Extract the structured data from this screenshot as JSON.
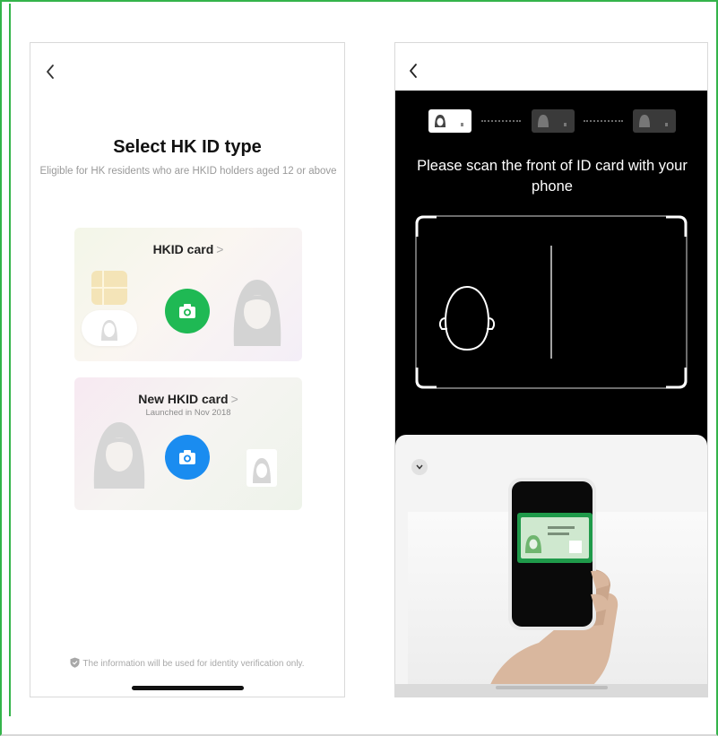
{
  "left_screen": {
    "back_icon": "chevron-left-icon",
    "title": "Select HK ID type",
    "subtitle": "Eligible for HK residents who are HKID holders aged 12 or above",
    "options": [
      {
        "label": "HKID card",
        "chevron": ">",
        "sublabel": "",
        "button_color": "#1fb954",
        "icon": "camera-icon"
      },
      {
        "label": "New HKID card",
        "chevron": ">",
        "sublabel": "Launched in Nov 2018",
        "button_color": "#1a8cf0",
        "icon": "camera-icon"
      }
    ],
    "privacy_note": "The information will be used for identity verification only."
  },
  "right_screen": {
    "back_icon": "chevron-left-icon",
    "steps": [
      {
        "state": "active"
      },
      {
        "state": "pending"
      },
      {
        "state": "pending"
      }
    ],
    "instruction": "Please scan the front of ID card with your phone",
    "collapse_icon": "chevron-down-icon"
  },
  "colors": {
    "border_green": "#34b44a",
    "hkid_green": "#1fb954",
    "new_hkid_blue": "#1a8cf0"
  }
}
